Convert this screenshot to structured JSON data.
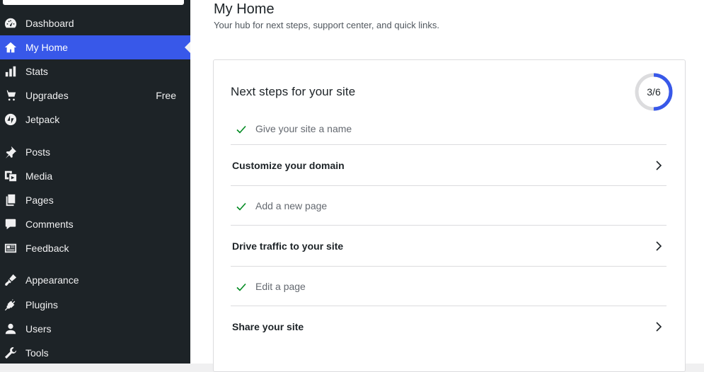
{
  "sidebar": {
    "items": [
      {
        "label": "Dashboard",
        "icon": "dashboard-icon"
      },
      {
        "label": "My Home",
        "icon": "home-icon",
        "active": true
      },
      {
        "label": "Stats",
        "icon": "stats-icon"
      },
      {
        "label": "Upgrades",
        "icon": "cart-icon",
        "badge": "Free"
      },
      {
        "label": "Jetpack",
        "icon": "jetpack-icon"
      },
      {
        "label": "Posts",
        "icon": "pin-icon"
      },
      {
        "label": "Media",
        "icon": "media-icon"
      },
      {
        "label": "Pages",
        "icon": "pages-icon"
      },
      {
        "label": "Comments",
        "icon": "comment-icon"
      },
      {
        "label": "Feedback",
        "icon": "feedback-icon"
      },
      {
        "label": "Appearance",
        "icon": "brush-icon"
      },
      {
        "label": "Plugins",
        "icon": "plug-icon"
      },
      {
        "label": "Users",
        "icon": "user-icon"
      },
      {
        "label": "Tools",
        "icon": "wrench-icon"
      }
    ]
  },
  "header": {
    "title": "My Home",
    "subtitle": "Your hub for next steps, support center, and quick links."
  },
  "card": {
    "title": "Next steps for your site",
    "progress_text": "3/6",
    "progress_fraction": 0.5,
    "steps": [
      {
        "label": "Give your site a name",
        "done": true
      },
      {
        "label": "Customize your domain",
        "done": false
      },
      {
        "label": "Add a new page",
        "done": true
      },
      {
        "label": "Drive traffic to your site",
        "done": false
      },
      {
        "label": "Edit a page",
        "done": true
      },
      {
        "label": "Share your site",
        "done": false
      }
    ]
  },
  "colors": {
    "sidebar_bg": "#1d2327",
    "accent": "#3858e9",
    "check": "#008a20",
    "border": "#dcdcde"
  }
}
